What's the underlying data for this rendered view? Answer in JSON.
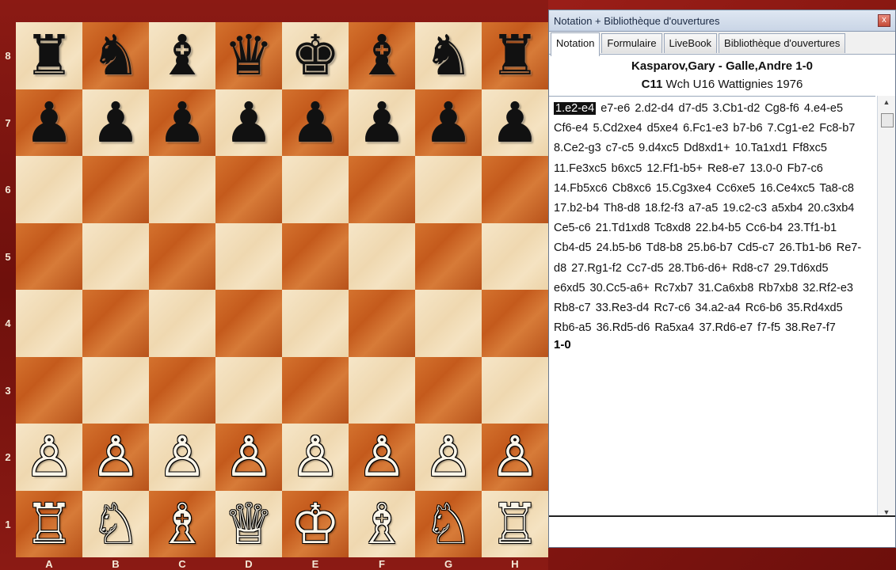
{
  "board": {
    "ranks": [
      "8",
      "7",
      "6",
      "5",
      "4",
      "3",
      "2",
      "1"
    ],
    "files": [
      "A",
      "B",
      "C",
      "D",
      "E",
      "F",
      "G",
      "H"
    ],
    "squares": [
      [
        "♜",
        "♞",
        "♝",
        "♛",
        "♚",
        "♝",
        "♞",
        "♜"
      ],
      [
        "♟",
        "♟",
        "♟",
        "♟",
        "♟",
        "♟",
        "♟",
        "♟"
      ],
      [
        "",
        "",
        "",
        "",
        "",
        "",
        "",
        ""
      ],
      [
        "",
        "",
        "",
        "",
        "",
        "",
        "",
        ""
      ],
      [
        "",
        "",
        "",
        "",
        "",
        "",
        "",
        ""
      ],
      [
        "",
        "",
        "",
        "",
        "",
        "",
        "",
        ""
      ],
      [
        "♙",
        "♙",
        "♙",
        "♙",
        "♙",
        "♙",
        "♙",
        "♙"
      ],
      [
        "♖",
        "♘",
        "♗",
        "♕",
        "♔",
        "♗",
        "♘",
        "♖"
      ]
    ]
  },
  "panel": {
    "title": "Notation + Bibliothèque d'ouvertures",
    "close_label": "x",
    "tabs": [
      "Notation",
      "Formulaire",
      "LiveBook",
      "Bibliothèque d'ouvertures"
    ],
    "active_tab": 0
  },
  "game": {
    "players": "Kasparov,Gary - Galle,Andre  1-0",
    "eco": "C11",
    "event": " Wch U16 Wattignies 1976",
    "first_move": "1.e2-e4",
    "moves": "e7-e6 2.d2-d4 d7-d5 3.Cb1-d2 Cg8-f6 4.e4-e5 Cf6-e4 5.Cd2xe4 d5xe4 6.Fc1-e3 b7-b6 7.Cg1-e2 Fc8-b7 8.Ce2-g3 c7-c5 9.d4xc5 Dd8xd1+ 10.Ta1xd1 Ff8xc5 11.Fe3xc5 b6xc5 12.Ff1-b5+ Re8-e7 13.0-0 Fb7-c6 14.Fb5xc6 Cb8xc6 15.Cg3xe4 Cc6xe5 16.Ce4xc5 Ta8-c8 17.b2-b4 Th8-d8 18.f2-f3 a7-a5 19.c2-c3 a5xb4 20.c3xb4 Ce5-c6 21.Td1xd8 Tc8xd8 22.b4-b5 Cc6-b4 23.Tf1-b1 Cb4-d5 24.b5-b6 Td8-b8 25.b6-b7 Cd5-c7 26.Tb1-b6 Re7-d8 27.Rg1-f2 Cc7-d5 28.Tb6-d6+ Rd8-c7 29.Td6xd5 e6xd5 30.Cc5-a6+ Rc7xb7 31.Ca6xb8 Rb7xb8 32.Rf2-e3 Rb8-c7 33.Re3-d4 Rc7-c6 34.a2-a4 Rc6-b6 35.Rd4xd5 Rb6-a5 36.Rd5-d6 Ra5xa4 37.Rd6-e7 f7-f5 38.Re7-f7",
    "result": "1-0"
  }
}
